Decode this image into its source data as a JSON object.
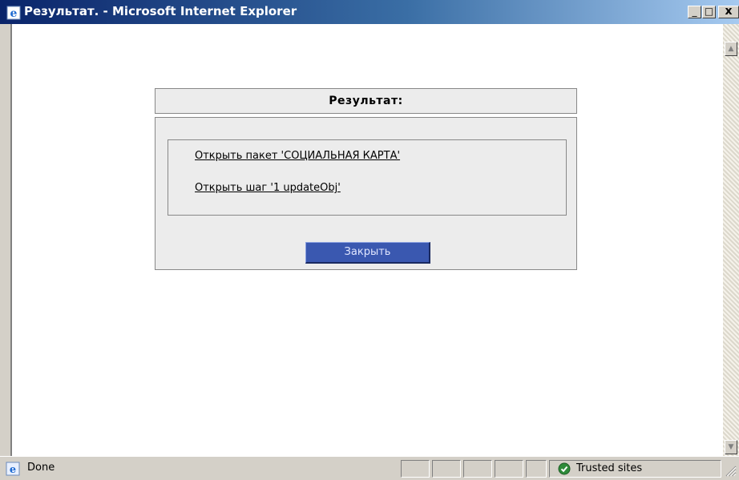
{
  "window": {
    "title": "Результат. - Microsoft Internet Explorer",
    "controls": {
      "minimize": "_",
      "maximize": "□",
      "close": "x"
    }
  },
  "dialog": {
    "header": "Результат:",
    "links": [
      "Открыть пакет 'СОЦИАЛЬНАЯ КАРТА'",
      "Открыть шаг '1 updateObj'"
    ],
    "close_button": "Закрыть"
  },
  "status_bar": {
    "status": "Done",
    "zone": "Trusted sites",
    "status_icon": "ie-page-icon",
    "zone_icon": "trusted-check-icon"
  },
  "colors": {
    "title_bar_start": "#0a246a",
    "title_bar_end": "#a6caf0",
    "close_button_bg": "#3a58b0",
    "panel_bg": "#ececec"
  }
}
